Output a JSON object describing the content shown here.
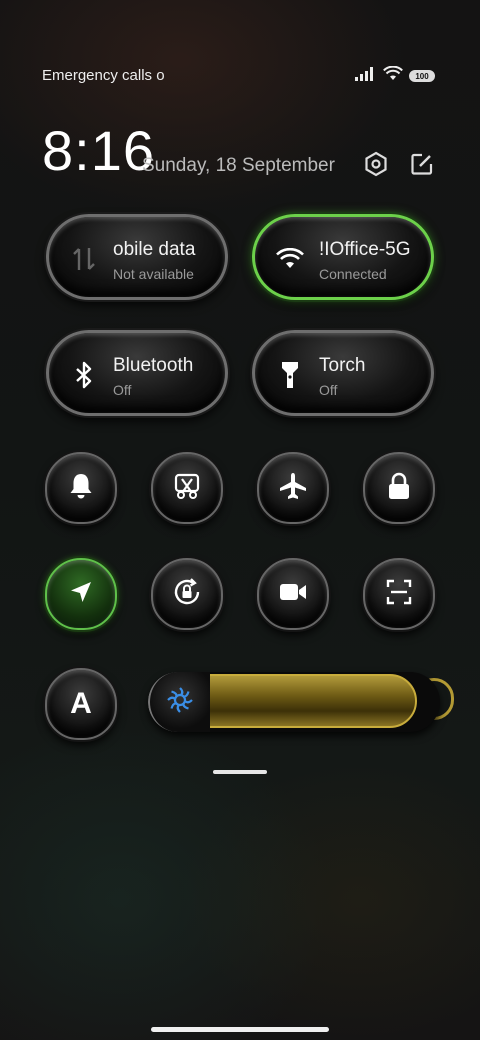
{
  "status_bar": {
    "text": "Emergency calls o",
    "battery": "100",
    "icons": [
      "signal-icon",
      "wifi-icon",
      "battery-icon"
    ]
  },
  "header": {
    "time": "8:16",
    "date": "Sunday, 18 September",
    "icons": [
      "settings-icon",
      "edit-icon"
    ]
  },
  "tiles": [
    {
      "title": "obile data",
      "subtitle": "Not available",
      "icon": "mobile-data-icon",
      "active": false
    },
    {
      "title": "!IOffice-5G",
      "subtitle": "Connected",
      "icon": "wifi-icon",
      "active": true
    },
    {
      "title": "Bluetooth",
      "subtitle": "Off",
      "icon": "bluetooth-icon",
      "active": false
    },
    {
      "title": "Torch",
      "subtitle": "Off",
      "icon": "torch-icon",
      "active": false
    }
  ],
  "toggles": [
    {
      "icon": "bell-icon",
      "active": false
    },
    {
      "icon": "screenshot-icon",
      "active": false
    },
    {
      "icon": "airplane-icon",
      "active": false
    },
    {
      "icon": "lock-icon",
      "active": false
    },
    {
      "icon": "location-icon",
      "active": true
    },
    {
      "icon": "rotation-lock-icon",
      "active": false
    },
    {
      "icon": "video-camera-icon",
      "active": false
    },
    {
      "icon": "scanner-icon",
      "active": false
    },
    {
      "icon": "auto-brightness-icon",
      "label": "A",
      "active": false
    }
  ],
  "brightness": {
    "level": 0.9,
    "icon": "brightness-icon"
  },
  "colors": {
    "active_green": "#6cd04a",
    "slider_gold": "#c8ac3c",
    "icon_blue": "#3a8ee6"
  }
}
